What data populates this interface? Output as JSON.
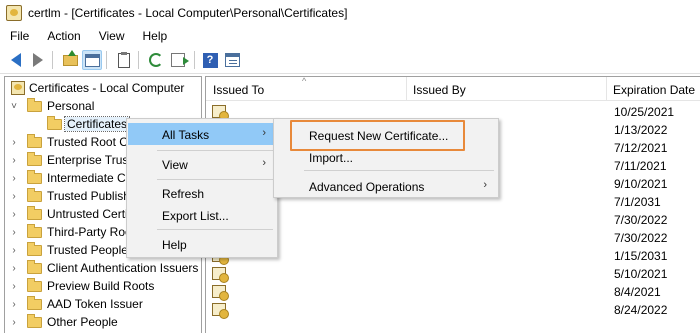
{
  "window": {
    "title": "certlm - [Certificates - Local Computer\\Personal\\Certificates]"
  },
  "menu": [
    "File",
    "Action",
    "View",
    "Help"
  ],
  "toolbar": {
    "buttons": [
      "back-arrow-icon",
      "forward-arrow-icon",
      "up-folder-icon",
      "show-hide-tree-icon",
      "clipboard-icon",
      "refresh-icon",
      "export-list-icon",
      "help-icon",
      "properties-icon"
    ]
  },
  "tree": {
    "items": [
      {
        "label": "Certificates - Local Computer",
        "level": 0,
        "expander": ""
      },
      {
        "label": "Personal",
        "level": 1,
        "expander": "v"
      },
      {
        "label": "Certificates",
        "level": 2,
        "expander": ""
      },
      {
        "label": "Trusted Root C",
        "level": 1,
        "expander": ">"
      },
      {
        "label": "Enterprise Trust",
        "level": 1,
        "expander": ">"
      },
      {
        "label": "Intermediate C",
        "level": 1,
        "expander": ">"
      },
      {
        "label": "Trusted Publish",
        "level": 1,
        "expander": ">"
      },
      {
        "label": "Untrusted Certi",
        "level": 1,
        "expander": ">"
      },
      {
        "label": "Third-Party Roo",
        "level": 1,
        "expander": ">"
      },
      {
        "label": "Trusted People",
        "level": 1,
        "expander": ">"
      },
      {
        "label": "Client Authentication Issuers",
        "level": 1,
        "expander": ">"
      },
      {
        "label": "Preview Build Roots",
        "level": 1,
        "expander": ">"
      },
      {
        "label": "AAD Token Issuer",
        "level": 1,
        "expander": ">"
      },
      {
        "label": "Other People",
        "level": 1,
        "expander": ">"
      }
    ]
  },
  "list": {
    "columns": [
      "Issued To",
      "Issued By",
      "Expiration Date"
    ],
    "sort_indicator": "^",
    "expiration_dates": [
      "10/25/2021",
      "1/13/2022",
      "7/12/2021",
      "7/11/2021",
      "9/10/2021",
      "7/1/2031",
      "7/30/2022",
      "7/30/2022",
      "1/15/2031",
      "5/10/2021",
      "8/4/2021",
      "8/24/2022"
    ]
  },
  "context_menu": {
    "items": [
      {
        "label": "All Tasks",
        "submenu": true,
        "hover": true
      },
      {
        "label": "View",
        "submenu": true
      },
      {
        "label": "Refresh",
        "submenu": false
      },
      {
        "label": "Export List...",
        "submenu": false
      },
      {
        "label": "Help",
        "submenu": false
      }
    ],
    "submenu_arrow": ">"
  },
  "all_tasks_submenu": {
    "items": [
      {
        "label": "Request New Certificate..."
      },
      {
        "label": "Import..."
      },
      {
        "label": "Advanced Operations",
        "submenu": true
      }
    ]
  },
  "colors": {
    "menu_hover": "#91c9f7",
    "highlight_border": "#e8893a",
    "folder": "#f2cd63"
  }
}
